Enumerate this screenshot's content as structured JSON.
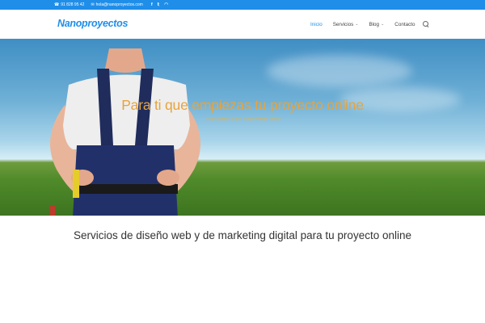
{
  "topbar": {
    "phone": "91 828 95 42",
    "email": "hola@nanoproyectos.com",
    "social_icons": [
      "facebook-icon",
      "twitter-icon",
      "rss-icon"
    ]
  },
  "header": {
    "logo_text": "Nanoproyectos",
    "nav": [
      {
        "label": "Inicio",
        "active": true,
        "dropdown": false
      },
      {
        "label": "Servicios",
        "active": false,
        "dropdown": true
      },
      {
        "label": "Blog",
        "active": false,
        "dropdown": true
      },
      {
        "label": "Contacto",
        "active": false,
        "dropdown": false
      }
    ]
  },
  "hero": {
    "title": "Para ti que empiezas tu proyecto online",
    "subtitle": "Te ayudamos a dar tus primeros pasos"
  },
  "section": {
    "title": "Servicios de diseño web y de marketing digital para tu proyecto online"
  },
  "colors": {
    "accent": "#1f8ee9",
    "hero_text": "#e8a33c"
  }
}
